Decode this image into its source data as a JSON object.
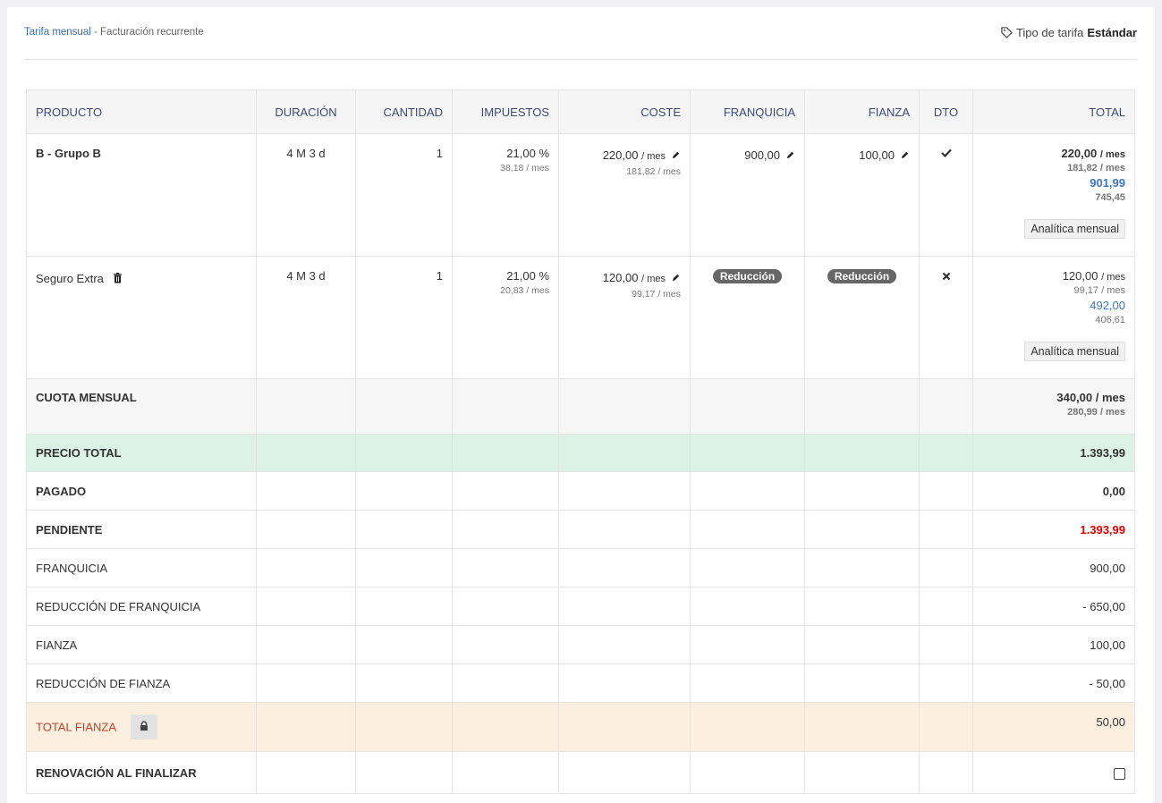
{
  "header": {
    "crumb_link": "Tarifa mensual",
    "crumb_sep": " - ",
    "crumb_text": "Facturación recurrente",
    "tarifa_label": "Tipo de tarifa",
    "tarifa_value": "Estándar"
  },
  "table": {
    "columns": [
      "PRODUCTO",
      "DURACIÓN",
      "CANTIDAD",
      "IMPUESTOS",
      "COSTE",
      "FRANQUICIA",
      "FIANZA",
      "DTO",
      "TOTAL"
    ],
    "rows": [
      {
        "producto": "B - Grupo B",
        "duracion": "4 M 3 d",
        "cantidad": "1",
        "impuestos": "21,00 %",
        "impuestos_sub": "38,18",
        "coste": "220,00",
        "coste_sub": "181,82",
        "franquicia": "900,00",
        "fianza": "100,00",
        "total": "220,00",
        "total_sub": "181,82",
        "total_blue": "901,99",
        "total_blue_sub": "745,45",
        "analitica": "Analítica mensual"
      },
      {
        "producto": "Seguro Extra",
        "duracion": "4 M 3 d",
        "cantidad": "1",
        "impuestos": "21,00 %",
        "impuestos_sub": "20,83",
        "coste": "120,00",
        "coste_sub": "99,17",
        "franquicia_badge": "Reducción",
        "fianza_badge": "Reducción",
        "total": "120,00",
        "total_sub": "99,17",
        "total_blue": "492,00",
        "total_blue_sub": "406,61",
        "analitica": "Analítica mensual"
      }
    ],
    "per_month": "/ mes",
    "cuota": {
      "label": "CUOTA MENSUAL",
      "value": "340,00 / mes",
      "sub": "280,99 / mes"
    },
    "precio_total": {
      "label": "PRECIO TOTAL",
      "value": "1.393,99"
    },
    "pagado": {
      "label": "PAGADO",
      "value": "0,00"
    },
    "pendiente": {
      "label": "PENDIENTE",
      "value": "1.393,99"
    },
    "franquicia": {
      "label": "FRANQUICIA",
      "value": "900,00"
    },
    "red_franquicia": {
      "label": "REDUCCIÓN DE FRANQUICIA",
      "value": "- 650,00"
    },
    "fianza": {
      "label": "FIANZA",
      "value": "100,00"
    },
    "red_fianza": {
      "label": "REDUCCIÓN DE FIANZA",
      "value": "- 50,00"
    },
    "total_fianza": {
      "label": "TOTAL FIANZA",
      "value": "50,00"
    },
    "renovacion": {
      "label": "RENOVACIÓN AL FINALIZAR",
      "checked": false
    }
  },
  "colors": {
    "link": "#3a6fb0",
    "header_text": "#3b4a73",
    "green_row": "#dcf2e6",
    "orange_row": "#fcefe0",
    "pending": "#e00000"
  }
}
